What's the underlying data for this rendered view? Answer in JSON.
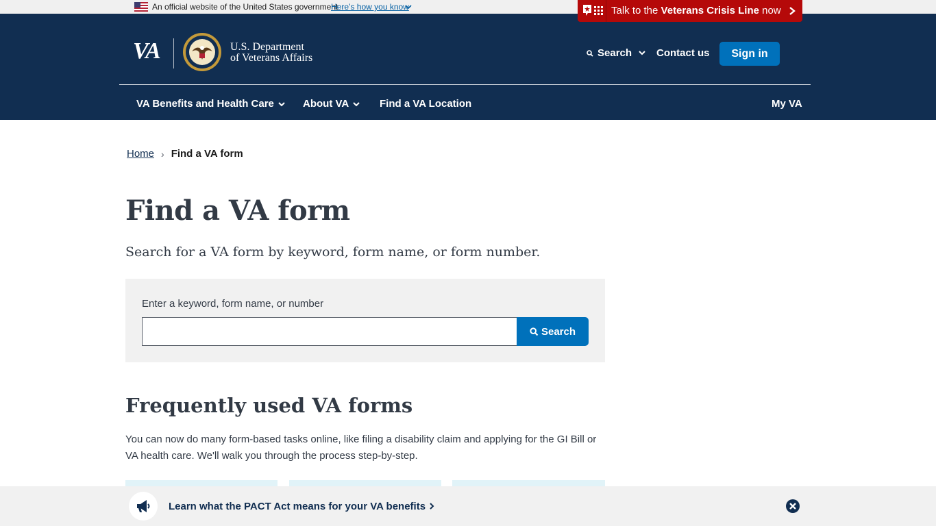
{
  "gov_banner": {
    "official_text": "An official website of the United States government",
    "how_link": "Here’s how you know"
  },
  "crisis_line": {
    "prefix": "Talk to the ",
    "bold": "Veterans Crisis Line",
    "suffix": " now"
  },
  "header": {
    "logo_text": "VA",
    "dept_line1": "U.S. Department",
    "dept_line2": "of Veterans Affairs",
    "search_label": "Search",
    "contact_label": "Contact us",
    "signin_label": "Sign in"
  },
  "nav": {
    "items": [
      {
        "label": "VA Benefits and Health Care",
        "has_menu": true
      },
      {
        "label": "About VA",
        "has_menu": true
      },
      {
        "label": "Find a VA Location",
        "has_menu": false
      }
    ],
    "my_va": "My VA"
  },
  "breadcrumb": {
    "home": "Home",
    "separator": "›",
    "current": "Find a VA form"
  },
  "main": {
    "title": "Find a VA form",
    "lead": "Search for a VA form by keyword, form name, or form number.",
    "search": {
      "label": "Enter a keyword, form name, or number",
      "value": "",
      "button": "Search"
    },
    "section_title": "Frequently used VA forms",
    "section_text": "You can now do many form-based tasks online, like filing a disability claim and applying for the GI Bill or VA health care. We'll walk you through the process step-by-step."
  },
  "promo_banner": {
    "link_text": "Learn what the PACT Act means for your VA benefits",
    "icon": "megaphone-icon"
  },
  "colors": {
    "header_bg": "#112e51",
    "crisis_bg": "#b50909",
    "primary": "#0071bb"
  }
}
